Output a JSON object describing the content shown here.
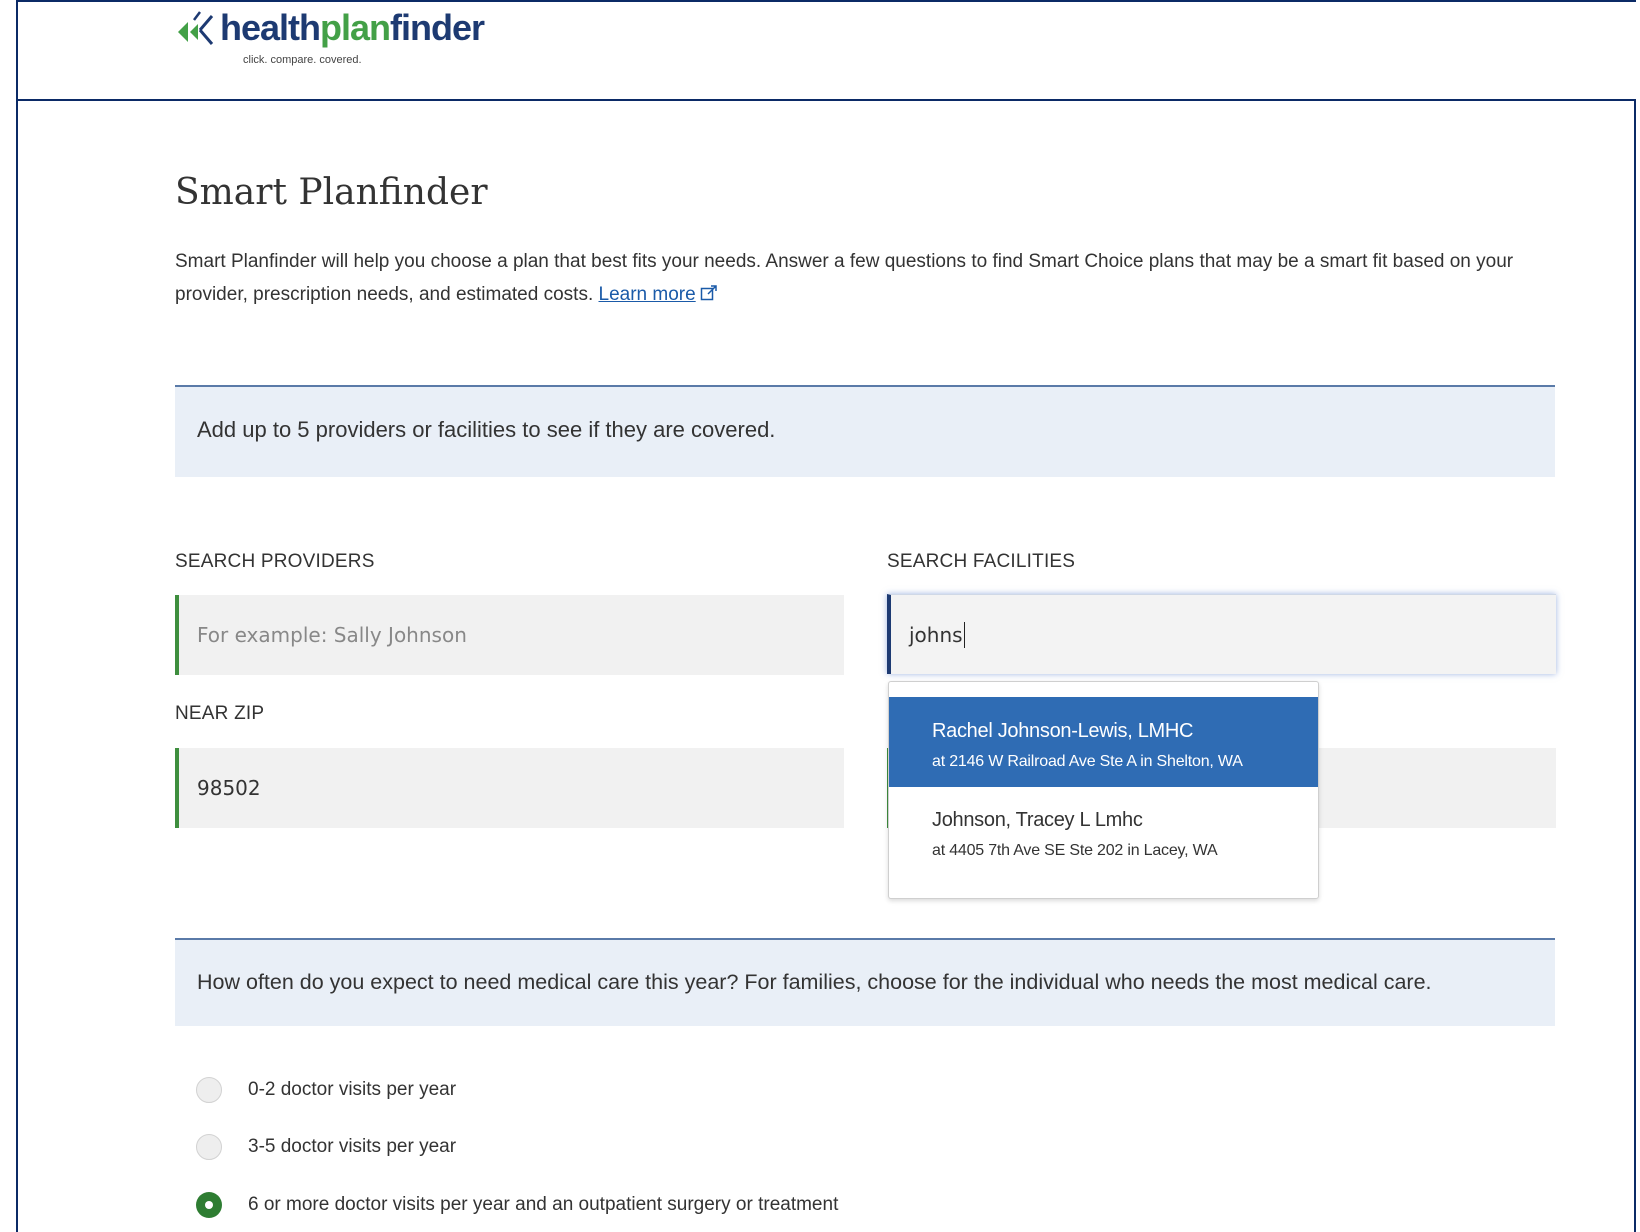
{
  "header": {
    "logo_text_a": "health",
    "logo_text_b": "plan",
    "logo_text_c": "finder",
    "tagline": "click. compare. covered."
  },
  "main": {
    "title": "Smart Planfinder",
    "intro": "Smart Planfinder will help you choose a plan that best fits your needs. Answer a few questions to find Smart Choice plans that may be a smart fit based on your provider, prescription needs, and estimated costs.",
    "learn_more": "Learn more"
  },
  "providers_panel": {
    "heading": "Add up to 5 providers or facilities to see if they are covered."
  },
  "search_providers": {
    "label": "SEARCH PROVIDERS",
    "placeholder": "For example: Sally Johnson",
    "value": ""
  },
  "near_zip": {
    "label": "NEAR ZIP",
    "value": "98502"
  },
  "search_facilities": {
    "label": "SEARCH FACILITIES",
    "value": "johns"
  },
  "suggestions": [
    {
      "name": "Rachel Johnson-Lewis, LMHC",
      "address": "at 2146 W Railroad Ave Ste A in Shelton, WA",
      "selected": true
    },
    {
      "name": "Johnson, Tracey L Lmhc",
      "address": "at 4405 7th Ave SE Ste 202 in Lacey, WA",
      "selected": false
    }
  ],
  "care_panel": {
    "question": "How often do you expect to need medical care this year? For families, choose for the individual who needs the most medical care."
  },
  "care_options": [
    {
      "label": "0-2 doctor visits per year",
      "checked": false
    },
    {
      "label": "3-5 doctor visits per year",
      "checked": false
    },
    {
      "label": "6 or more doctor visits per year and an outpatient surgery or treatment",
      "checked": true
    }
  ],
  "colors": {
    "brand_navy": "#1d3a72",
    "brand_green": "#43a047",
    "field_accent": "#3e8e3e",
    "selection_blue": "#2f6cb4",
    "panel_bg": "#e9eff7"
  }
}
